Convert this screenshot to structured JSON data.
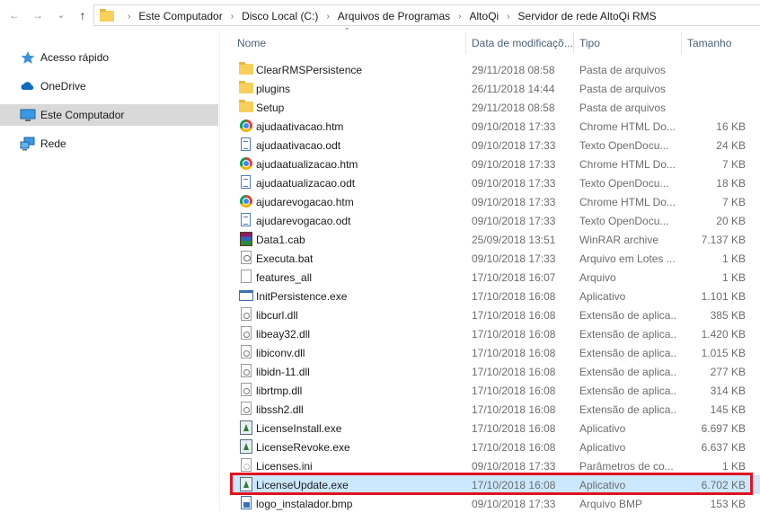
{
  "toolbar": {
    "back_glyph": "←",
    "forward_glyph": "→",
    "recent_glyph": "⌄",
    "up_glyph": "↑"
  },
  "breadcrumbs": [
    "Este Computador",
    "Disco Local (C:)",
    "Arquivos de Programas",
    "AltoQi",
    "Servidor de rede AltoQi RMS"
  ],
  "separator": "›",
  "sidebar": {
    "items": [
      {
        "label": "Acesso rápido",
        "icon": "star-icon",
        "selected": false
      },
      {
        "label": "OneDrive",
        "icon": "cloud-icon",
        "selected": false
      },
      {
        "label": "Este Computador",
        "icon": "computer-icon",
        "selected": true
      },
      {
        "label": "Rede",
        "icon": "network-icon",
        "selected": false
      }
    ]
  },
  "columns": {
    "name": "Nome",
    "date": "Data de modificaçõ...",
    "type": "Tipo",
    "size": "Tamanho",
    "sort_indicator": "⌃"
  },
  "files": [
    {
      "name": "ClearRMSPersistence",
      "date": "29/11/2018 08:58",
      "type": "Pasta de arquivos",
      "size": "",
      "icon": "folder-icon"
    },
    {
      "name": "plugins",
      "date": "26/11/2018 14:44",
      "type": "Pasta de arquivos",
      "size": "",
      "icon": "folder-icon"
    },
    {
      "name": "Setup",
      "date": "29/11/2018 08:58",
      "type": "Pasta de arquivos",
      "size": "",
      "icon": "folder-icon"
    },
    {
      "name": "ajudaativacao.htm",
      "date": "09/10/2018 17:33",
      "type": "Chrome HTML Do...",
      "size": "16 KB",
      "icon": "chrome-icon"
    },
    {
      "name": "ajudaativacao.odt",
      "date": "09/10/2018 17:33",
      "type": "Texto OpenDocu...",
      "size": "24 KB",
      "icon": "document-icon"
    },
    {
      "name": "ajudaatualizacao.htm",
      "date": "09/10/2018 17:33",
      "type": "Chrome HTML Do...",
      "size": "7 KB",
      "icon": "chrome-icon"
    },
    {
      "name": "ajudaatualizacao.odt",
      "date": "09/10/2018 17:33",
      "type": "Texto OpenDocu...",
      "size": "18 KB",
      "icon": "document-icon"
    },
    {
      "name": "ajudarevogacao.htm",
      "date": "09/10/2018 17:33",
      "type": "Chrome HTML Do...",
      "size": "7 KB",
      "icon": "chrome-icon"
    },
    {
      "name": "ajudarevogacao.odt",
      "date": "09/10/2018 17:33",
      "type": "Texto OpenDocu...",
      "size": "20 KB",
      "icon": "document-icon"
    },
    {
      "name": "Data1.cab",
      "date": "25/09/2018 13:51",
      "type": "WinRAR archive",
      "size": "7.137 KB",
      "icon": "winrar-icon"
    },
    {
      "name": "Executa.bat",
      "date": "09/10/2018 17:33",
      "type": "Arquivo em Lotes ...",
      "size": "1 KB",
      "icon": "batch-file-icon"
    },
    {
      "name": "features_all",
      "date": "17/10/2018 16:07",
      "type": "Arquivo",
      "size": "1 KB",
      "icon": "blank-file-icon"
    },
    {
      "name": "InitPersistence.exe",
      "date": "17/10/2018 16:08",
      "type": "Aplicativo",
      "size": "1.101 KB",
      "icon": "application-icon"
    },
    {
      "name": "libcurl.dll",
      "date": "17/10/2018 16:08",
      "type": "Extensão de aplica...",
      "size": "385 KB",
      "icon": "dll-icon"
    },
    {
      "name": "libeay32.dll",
      "date": "17/10/2018 16:08",
      "type": "Extensão de aplica...",
      "size": "1.420 KB",
      "icon": "dll-icon"
    },
    {
      "name": "libiconv.dll",
      "date": "17/10/2018 16:08",
      "type": "Extensão de aplica...",
      "size": "1.015 KB",
      "icon": "dll-icon"
    },
    {
      "name": "libidn-11.dll",
      "date": "17/10/2018 16:08",
      "type": "Extensão de aplica...",
      "size": "277 KB",
      "icon": "dll-icon"
    },
    {
      "name": "librtmp.dll",
      "date": "17/10/2018 16:08",
      "type": "Extensão de aplica...",
      "size": "314 KB",
      "icon": "dll-icon"
    },
    {
      "name": "libssh2.dll",
      "date": "17/10/2018 16:08",
      "type": "Extensão de aplica...",
      "size": "145 KB",
      "icon": "dll-icon"
    },
    {
      "name": "LicenseInstall.exe",
      "date": "17/10/2018 16:08",
      "type": "Aplicativo",
      "size": "6.697 KB",
      "icon": "license-app-icon"
    },
    {
      "name": "LicenseRevoke.exe",
      "date": "17/10/2018 16:08",
      "type": "Aplicativo",
      "size": "6.637 KB",
      "icon": "license-app-icon"
    },
    {
      "name": "Licenses.ini",
      "date": "09/10/2018 17:33",
      "type": "Parâmetros de co...",
      "size": "1 KB",
      "icon": "settings-file-icon"
    },
    {
      "name": "LicenseUpdate.exe",
      "date": "17/10/2018 16:08",
      "type": "Aplicativo",
      "size": "6.702 KB",
      "icon": "license-app-icon"
    },
    {
      "name": "logo_instalador.bmp",
      "date": "09/10/2018 17:33",
      "type": "Arquivo BMP",
      "size": "153 KB",
      "icon": "image-file-icon"
    }
  ],
  "selected_file": "LicenseUpdate.exe",
  "colors": {
    "selection": "#cce8ff",
    "highlight_box": "#e0131f",
    "sidebar_selected": "#d9d9d9",
    "header_text": "#4c607a"
  }
}
